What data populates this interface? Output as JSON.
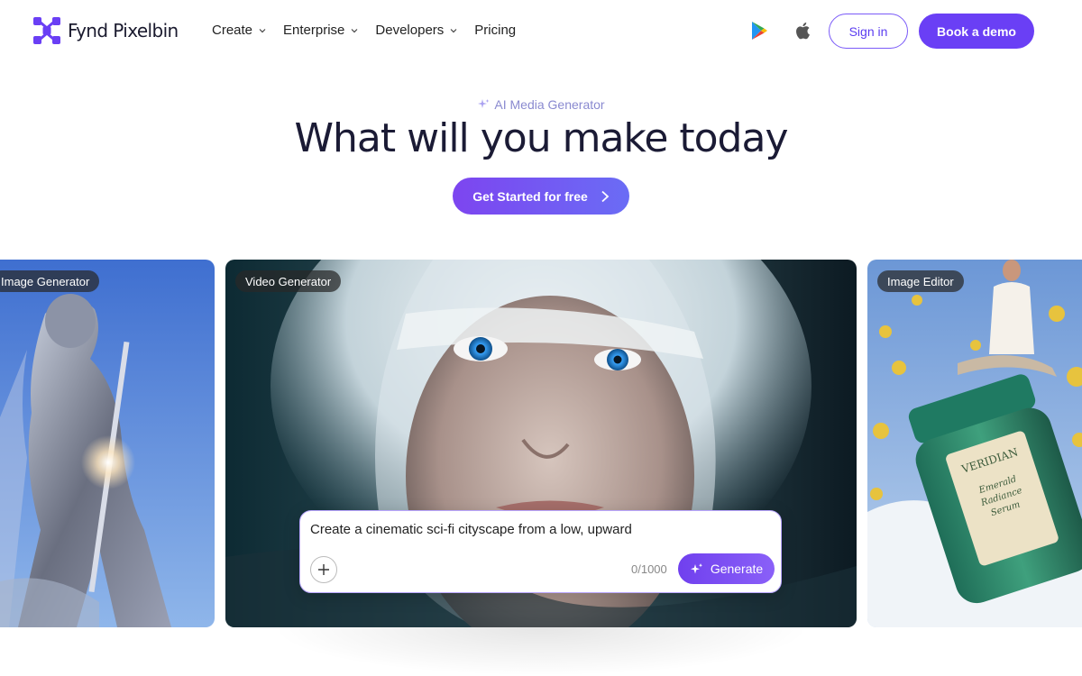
{
  "brand": {
    "name": "Fynd Pixelbin",
    "logo_icon": "pixelbin-x-logo-icon",
    "color": "#6a3ff5"
  },
  "nav": {
    "items": [
      {
        "label": "Create",
        "has_dropdown": true
      },
      {
        "label": "Enterprise",
        "has_dropdown": true
      },
      {
        "label": "Developers",
        "has_dropdown": true
      },
      {
        "label": "Pricing",
        "has_dropdown": false
      }
    ],
    "store_icons": [
      "google-play-icon",
      "apple-icon"
    ],
    "sign_in_label": "Sign in",
    "book_demo_label": "Book a demo"
  },
  "hero": {
    "eyebrow": "AI Media Generator",
    "eyebrow_icon": "sparkle-icon",
    "title": "What will you make today",
    "cta_label": "Get Started for free",
    "cta_icon": "chevron-right-icon"
  },
  "cards": [
    {
      "tag": "Image Generator",
      "image": "armored-knight-image"
    },
    {
      "tag": "Video Generator",
      "image": "platinum-haired-woman-portrait-image"
    },
    {
      "tag": "Image Editor",
      "image": "veridian-serum-jar-image"
    }
  ],
  "prompt_box": {
    "value": "Create a cinematic sci-fi cityscape from a low, upward",
    "counter": "0/1000",
    "generate_label": "Generate",
    "add_icon": "plus-icon",
    "generate_icon": "sparkle-icon"
  },
  "product_label": {
    "brand": "VERIDIAN",
    "line1": "Emerald",
    "line2": "Radiance",
    "line3": "Serum"
  },
  "colors": {
    "accent": "#6a3ff5",
    "cta_gradient_start": "#7d45f0",
    "cta_gradient_end": "#6a6cf5",
    "text_dark": "#1b1b35"
  }
}
